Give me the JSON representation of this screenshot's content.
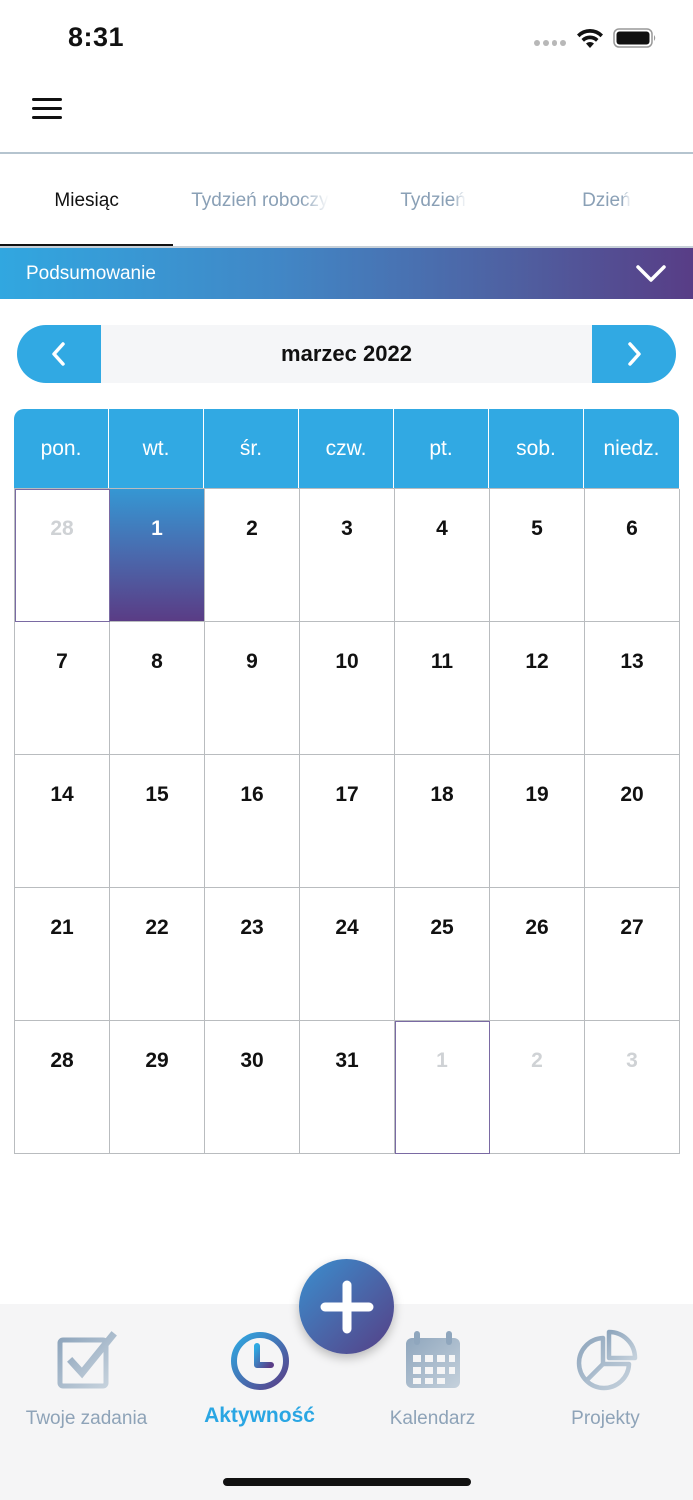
{
  "status_bar": {
    "time": "8:31"
  },
  "tabs": [
    {
      "label": "Miesiąc",
      "active": true
    },
    {
      "label": "Tydzień roboczy",
      "active": false
    },
    {
      "label": "Tydzień",
      "active": false
    },
    {
      "label": "Dzień",
      "active": false
    }
  ],
  "summary": {
    "label": "Podsumowanie"
  },
  "month_nav": {
    "title": "marzec 2022"
  },
  "weekdays": [
    "pon.",
    "wt.",
    "śr.",
    "czw.",
    "pt.",
    "sob.",
    "niedz."
  ],
  "days": [
    {
      "day": "28",
      "muted": true,
      "outlined": true
    },
    {
      "day": "1",
      "today": true
    },
    {
      "day": "2"
    },
    {
      "day": "3"
    },
    {
      "day": "4"
    },
    {
      "day": "5"
    },
    {
      "day": "6"
    },
    {
      "day": "7"
    },
    {
      "day": "8"
    },
    {
      "day": "9"
    },
    {
      "day": "10"
    },
    {
      "day": "11"
    },
    {
      "day": "12"
    },
    {
      "day": "13"
    },
    {
      "day": "14"
    },
    {
      "day": "15"
    },
    {
      "day": "16"
    },
    {
      "day": "17"
    },
    {
      "day": "18"
    },
    {
      "day": "19"
    },
    {
      "day": "20"
    },
    {
      "day": "21"
    },
    {
      "day": "22"
    },
    {
      "day": "23"
    },
    {
      "day": "24"
    },
    {
      "day": "25"
    },
    {
      "day": "26"
    },
    {
      "day": "27"
    },
    {
      "day": "28"
    },
    {
      "day": "29"
    },
    {
      "day": "30"
    },
    {
      "day": "31"
    },
    {
      "day": "1",
      "muted": true,
      "outlined": true
    },
    {
      "day": "2",
      "muted": true
    },
    {
      "day": "3",
      "muted": true
    }
  ],
  "bottom_nav": {
    "items": [
      {
        "label": "Twoje zadania",
        "icon": "checkbox-icon",
        "active": false
      },
      {
        "label": "Aktywność",
        "icon": "clock-icon",
        "active": true
      },
      {
        "label": "Kalendarz",
        "icon": "calendar-icon",
        "active": false
      },
      {
        "label": "Projekty",
        "icon": "pie-chart-icon",
        "active": false
      }
    ],
    "fab_icon": "plus-icon"
  },
  "colors": {
    "accent": "#31a9e3",
    "gradient_end": "#583d86",
    "muted_text": "#8ea3b8"
  }
}
